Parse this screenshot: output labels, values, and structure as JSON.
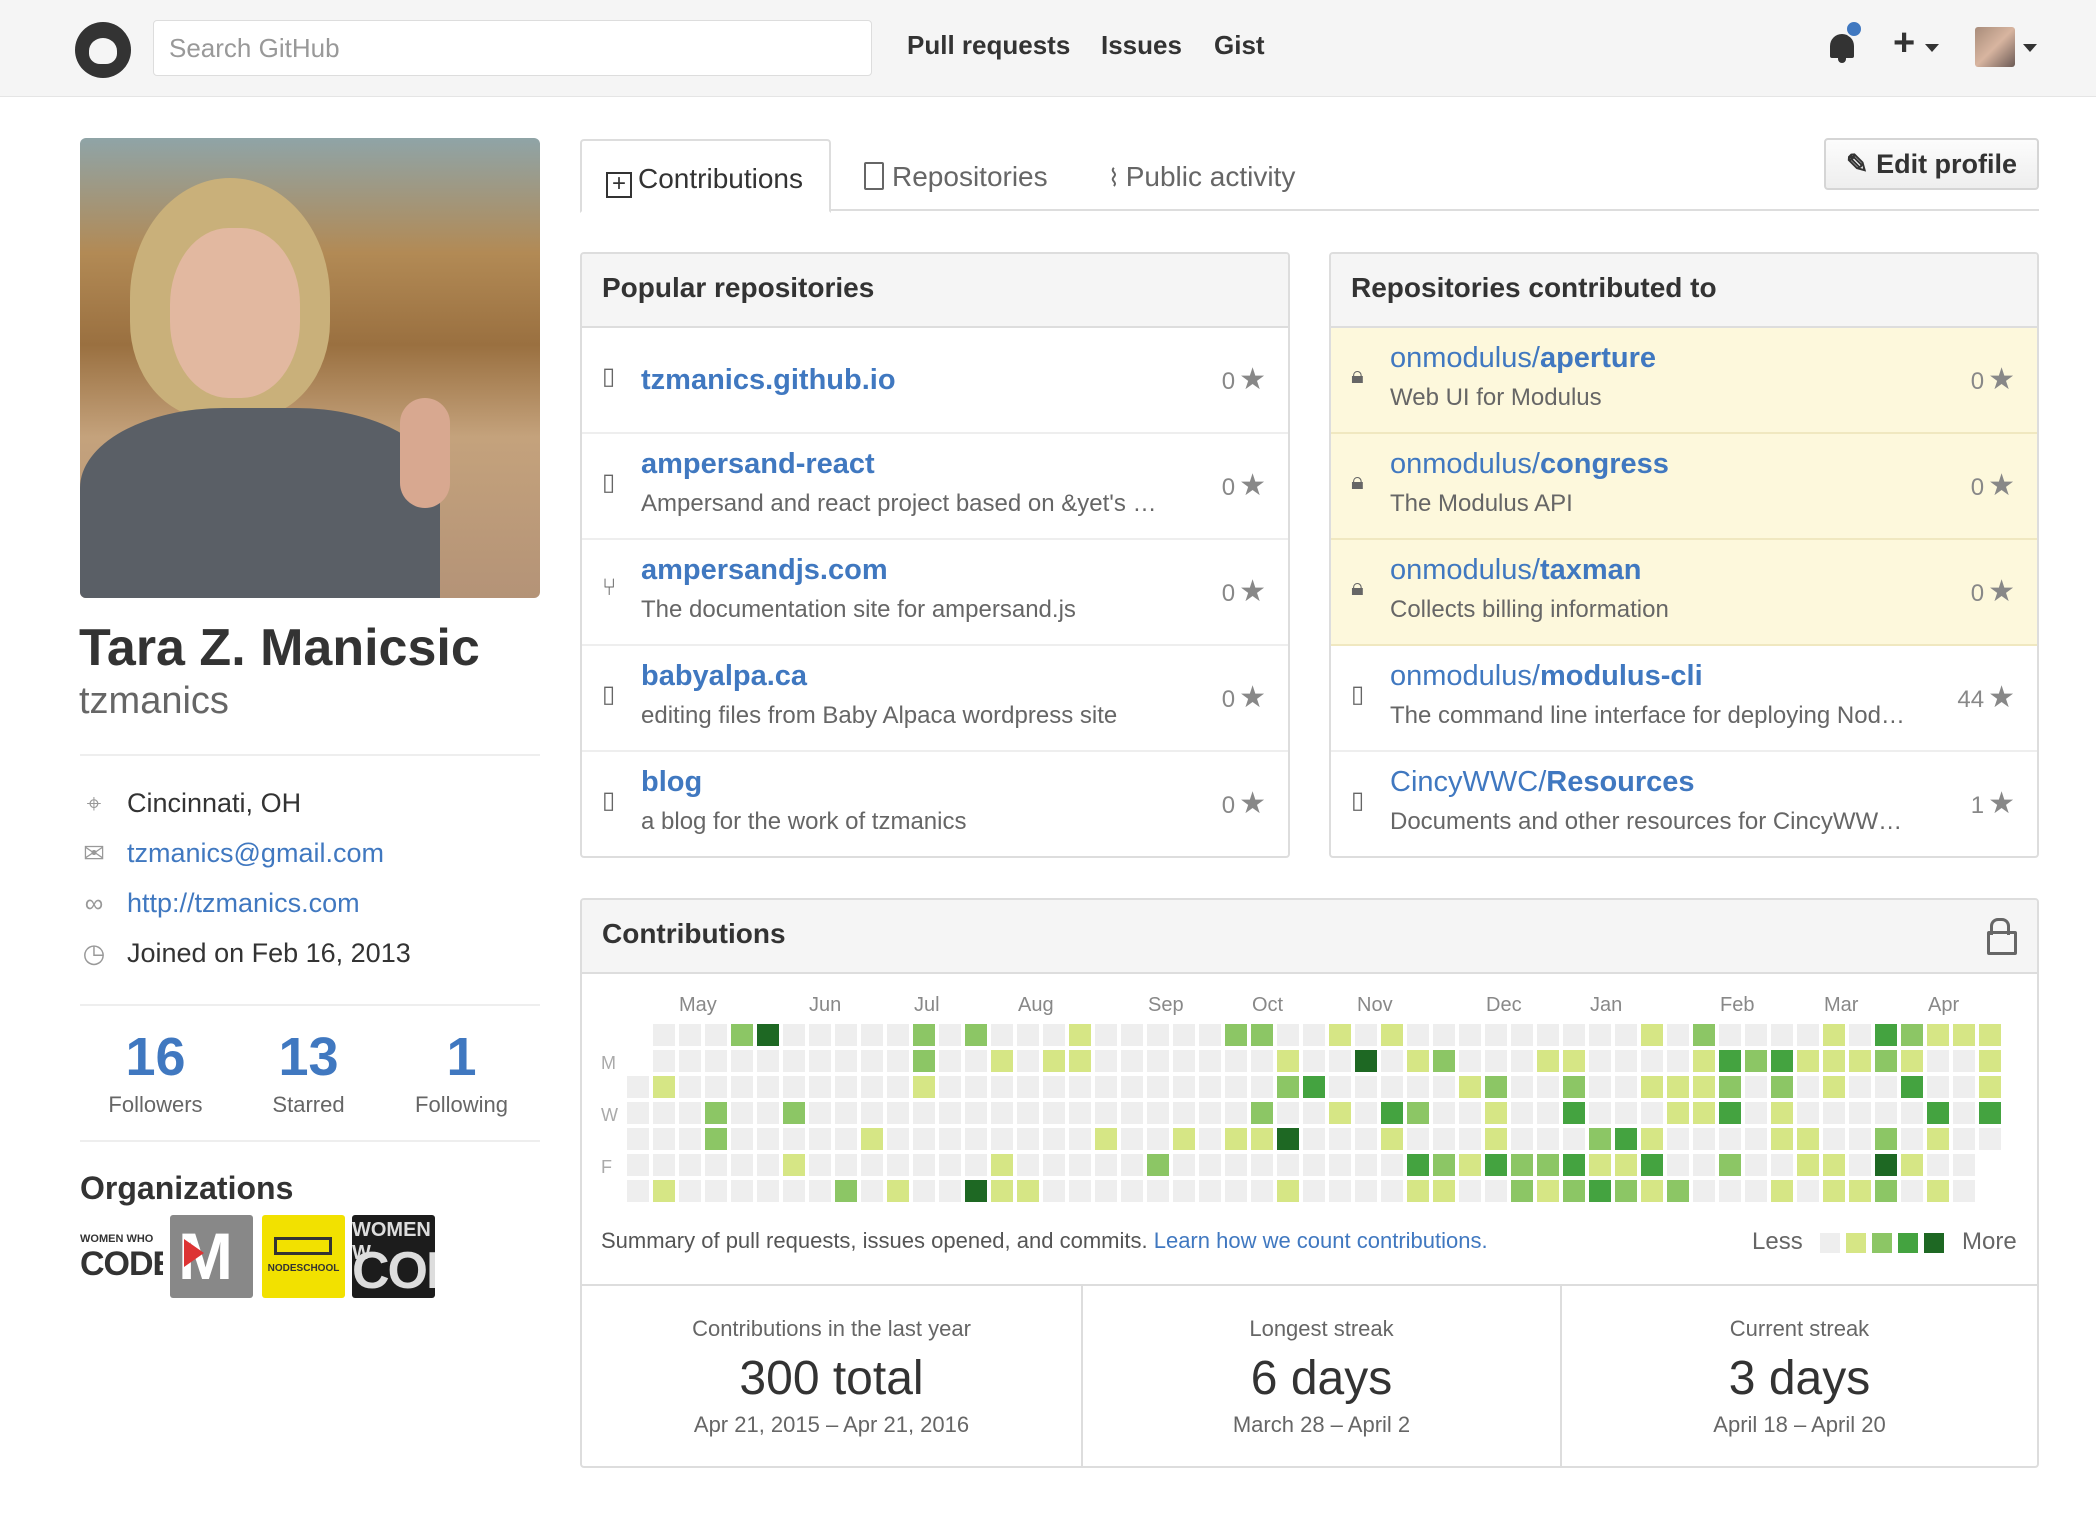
{
  "header": {
    "search_placeholder": "Search GitHub",
    "nav": [
      "Pull requests",
      "Issues",
      "Gist"
    ],
    "plus": "+"
  },
  "profile": {
    "name": "Tara Z. Manicsic",
    "login": "tzmanics",
    "location": "Cincinnati, OH",
    "email": "tzmanics@gmail.com",
    "url": "http://tzmanics.com",
    "joined": "Joined on Feb 16, 2013",
    "stats": [
      {
        "num": "16",
        "label": "Followers"
      },
      {
        "num": "13",
        "label": "Starred"
      },
      {
        "num": "1",
        "label": "Following"
      }
    ],
    "organizations_title": "Organizations",
    "orgs": [
      {
        "name": "women-who-code",
        "top": "WOMEN WHO",
        "bottom": "CODE"
      },
      {
        "name": "modulus",
        "text": "M"
      },
      {
        "name": "nodeschool",
        "text": "NODESCHOOL"
      },
      {
        "name": "women-who-code-cincy",
        "top": "WOMEN W",
        "bottom": "COD"
      }
    ]
  },
  "tabs": [
    "Contributions",
    "Repositories",
    "Public activity"
  ],
  "edit_profile": "Edit profile",
  "popular": {
    "title": "Popular repositories",
    "items": [
      {
        "name": "tzmanics.github.io",
        "desc": "",
        "stars": "0",
        "icon": "repo-icon"
      },
      {
        "name": "ampersand-react",
        "desc": "Ampersand and react project based on &yet's …",
        "stars": "0",
        "icon": "repo-icon"
      },
      {
        "name": "ampersandjs.com",
        "desc": "The documentation site for ampersand.js",
        "stars": "0",
        "icon": "fork-icon"
      },
      {
        "name": "babyalpa.ca",
        "desc": "editing files from Baby Alpaca wordpress site",
        "stars": "0",
        "icon": "repo-icon"
      },
      {
        "name": "blog",
        "desc": "a blog for the work of tzmanics",
        "stars": "0",
        "icon": "repo-icon"
      }
    ]
  },
  "contributed": {
    "title": "Repositories contributed to",
    "items": [
      {
        "owner": "onmodulus/",
        "name": "aperture",
        "desc": "Web UI for Modulus",
        "stars": "0",
        "private": true
      },
      {
        "owner": "onmodulus/",
        "name": "congress",
        "desc": "The Modulus API",
        "stars": "0",
        "private": true
      },
      {
        "owner": "onmodulus/",
        "name": "taxman",
        "desc": "Collects billing information",
        "stars": "0",
        "private": true
      },
      {
        "owner": "onmodulus/",
        "name": "modulus-cli",
        "desc": "The command line interface for deploying Nod…",
        "stars": "44",
        "private": false
      },
      {
        "owner": "CincyWWC/",
        "name": "Resources",
        "desc": "Documents and other resources for CincyWW…",
        "stars": "1",
        "private": false
      }
    ]
  },
  "contributions": {
    "title": "Contributions",
    "months": [
      "May",
      "Jun",
      "Jul",
      "Aug",
      "Sep",
      "Oct",
      "Nov",
      "Dec",
      "Jan",
      "Feb",
      "Mar",
      "Apr"
    ],
    "day_labels": [
      "M",
      "W",
      "F"
    ],
    "summary": "Summary of pull requests, issues opened, and commits.",
    "learn_link": "Learn how we count contributions.",
    "legend_less": "Less",
    "legend_more": "More",
    "colors": [
      "#eeeeee",
      "#d6e685",
      "#8cc665",
      "#44a340",
      "#1e6823"
    ],
    "stats": [
      {
        "label": "Contributions in the last year",
        "value": "300 total",
        "range": "Apr 21, 2015 – Apr 21, 2016"
      },
      {
        "label": "Longest streak",
        "value": "6 days",
        "range": "March 28 – April 2"
      },
      {
        "label": "Current streak",
        "value": "3 days",
        "range": "April 18 – April 20"
      }
    ]
  }
}
